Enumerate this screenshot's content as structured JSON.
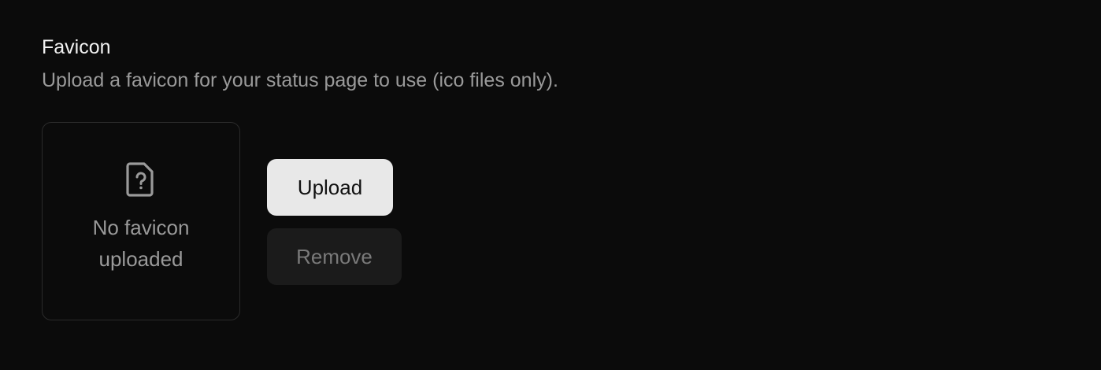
{
  "favicon": {
    "title": "Favicon",
    "description": "Upload a favicon for your status page to use (ico files only).",
    "preview": {
      "icon": "file-question-icon",
      "empty_text": "No favicon uploaded"
    },
    "upload_label": "Upload",
    "remove_label": "Remove"
  },
  "colors": {
    "background": "#0b0b0b",
    "upload_button_bg": "#e8e8e8",
    "remove_button_bg": "#1b1b1b",
    "muted_text": "#9a9a9a"
  }
}
